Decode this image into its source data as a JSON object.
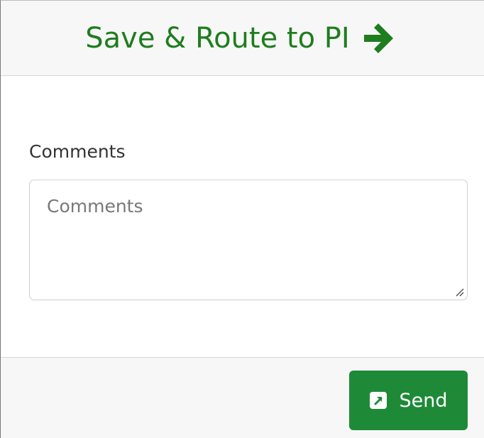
{
  "header": {
    "title": "Save & Route to PI",
    "icon": "arrow-right-icon",
    "color": "#1e7d1e"
  },
  "comments": {
    "label": "Comments",
    "placeholder": "Comments",
    "value": ""
  },
  "footer": {
    "send_label": "Send",
    "send_icon": "external-link-square-icon",
    "button_color": "#1e8a38"
  }
}
